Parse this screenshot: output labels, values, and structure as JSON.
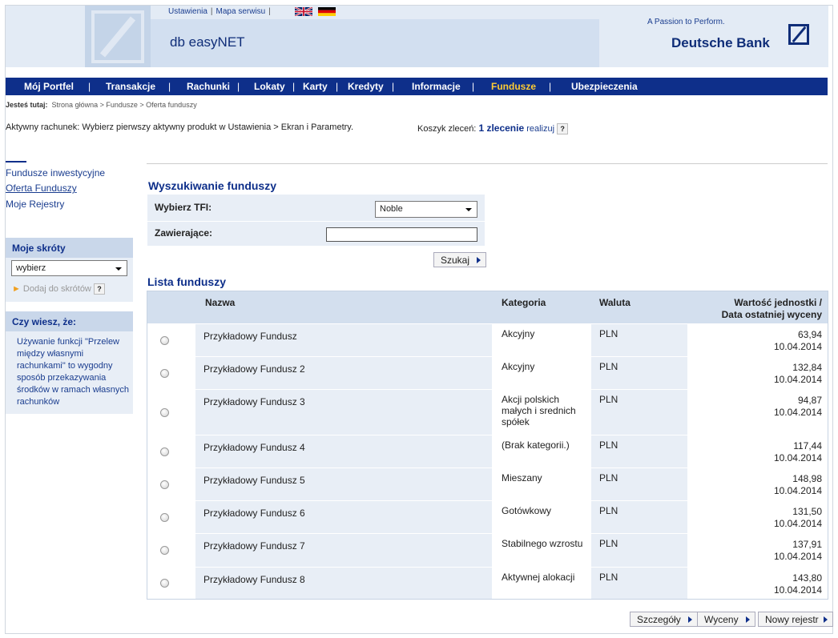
{
  "header": {
    "links": [
      "Ustawienia",
      "Mapa serwisu"
    ],
    "product": "db easyNET",
    "slogan": "A Passion to Perform.",
    "bank": "Deutsche Bank"
  },
  "nav": [
    {
      "label": "Mój Portfel"
    },
    {
      "label": "Transakcje"
    },
    {
      "label": "Rachunki"
    },
    {
      "label": "Lokaty"
    },
    {
      "label": "Karty"
    },
    {
      "label": "Kredyty"
    },
    {
      "label": "Informacje"
    },
    {
      "label": "Fundusze",
      "active": true
    },
    {
      "label": "Ubezpieczenia"
    }
  ],
  "breadcrumb": {
    "prefix": "Jesteś tutaj:",
    "items": [
      "Strona główna",
      "Fundusze",
      "Oferta funduszy"
    ]
  },
  "active_account": "Aktywny rachunek:  Wybierz pierwszy aktywny produkt w Ustawienia > Ekran i Parametry.",
  "cart": {
    "label": "Koszyk zleceń:",
    "count": "1 zlecenie",
    "action": "realizuj",
    "help": "?"
  },
  "sidebar": {
    "links": [
      "Fundusze inwestycyjne",
      "Oferta Funduszy",
      "Moje Rejestry"
    ],
    "shortcuts_title": "Moje skróty",
    "shortcuts_value": "wybierz",
    "add_shortcut": "Dodaj do skrótów",
    "help": "?",
    "tip_title": "Czy wiesz, że:",
    "tip_text": "Używanie funkcji \"Przelew między własnymi rachunkami\" to wygodny sposób przekazywania środków w ramach własnych rachunków"
  },
  "search": {
    "title": "Wyszukiwanie funduszy",
    "tfi_label": "Wybierz TFI:",
    "tfi_value": "Noble",
    "contains_label": "Zawierające:",
    "contains_value": "",
    "button": "Szukaj"
  },
  "list": {
    "title": "Lista funduszy",
    "columns": {
      "name": "Nazwa",
      "category": "Kategoria",
      "currency": "Waluta",
      "value_l1": "Wartość jednostki /",
      "value_l2": "Data ostatniej wyceny"
    },
    "rows": [
      {
        "name": "Przykładowy Fundusz",
        "category": "Akcyjny",
        "currency": "PLN",
        "value": "63,94",
        "date": "10.04.2014"
      },
      {
        "name": "Przykładowy Fundusz 2",
        "category": "Akcyjny",
        "currency": "PLN",
        "value": "132,84",
        "date": "10.04.2014"
      },
      {
        "name": "Przykładowy Fundusz 3",
        "category": "Akcji polskich małych i srednich spółek",
        "currency": "PLN",
        "value": "94,87",
        "date": "10.04.2014"
      },
      {
        "name": "Przykładowy Fundusz 4",
        "category": "(Brak kategorii.)",
        "currency": "PLN",
        "value": "117,44",
        "date": "10.04.2014"
      },
      {
        "name": "Przykładowy Fundusz 5",
        "category": "Mieszany",
        "currency": "PLN",
        "value": "148,98",
        "date": "10.04.2014"
      },
      {
        "name": "Przykładowy Fundusz 6",
        "category": "Gotówkowy",
        "currency": "PLN",
        "value": "131,50",
        "date": "10.04.2014"
      },
      {
        "name": "Przykładowy Fundusz 7",
        "category": "Stabilnego wzrostu",
        "currency": "PLN",
        "value": "137,91",
        "date": "10.04.2014"
      },
      {
        "name": "Przykładowy Fundusz 8",
        "category": "Aktywnej alokacji",
        "currency": "PLN",
        "value": "143,80",
        "date": "10.04.2014"
      }
    ]
  },
  "buttons": {
    "details": "Szczegóły",
    "valuations": "Wyceny",
    "new_register": "Nowy rejestr"
  }
}
